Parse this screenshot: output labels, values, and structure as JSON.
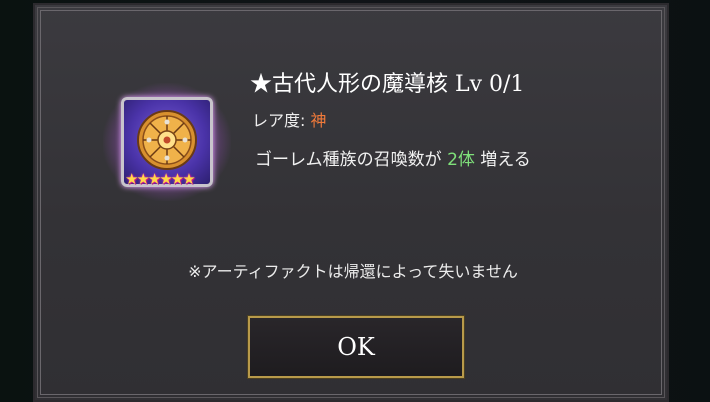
{
  "dialog": {
    "item_title": "★古代人形の魔導核 Lv 0/1",
    "rarity_label": "レア度: ",
    "rarity_value": "神",
    "description_prefix": "ゴーレム種族の召喚数が ",
    "description_highlight": "2体",
    "description_suffix": " 増える",
    "note": "※アーティファクトは帰還によって失いません",
    "ok_label": "OK",
    "star_rating": "★★★★★★"
  },
  "icons": {
    "artifact": "artifact-core-icon",
    "rating": "star-icon"
  },
  "colors": {
    "rarity": "#f07a3a",
    "highlight": "#7fe07a",
    "button_border": "#b89a4a",
    "glow": "#e278ff"
  }
}
